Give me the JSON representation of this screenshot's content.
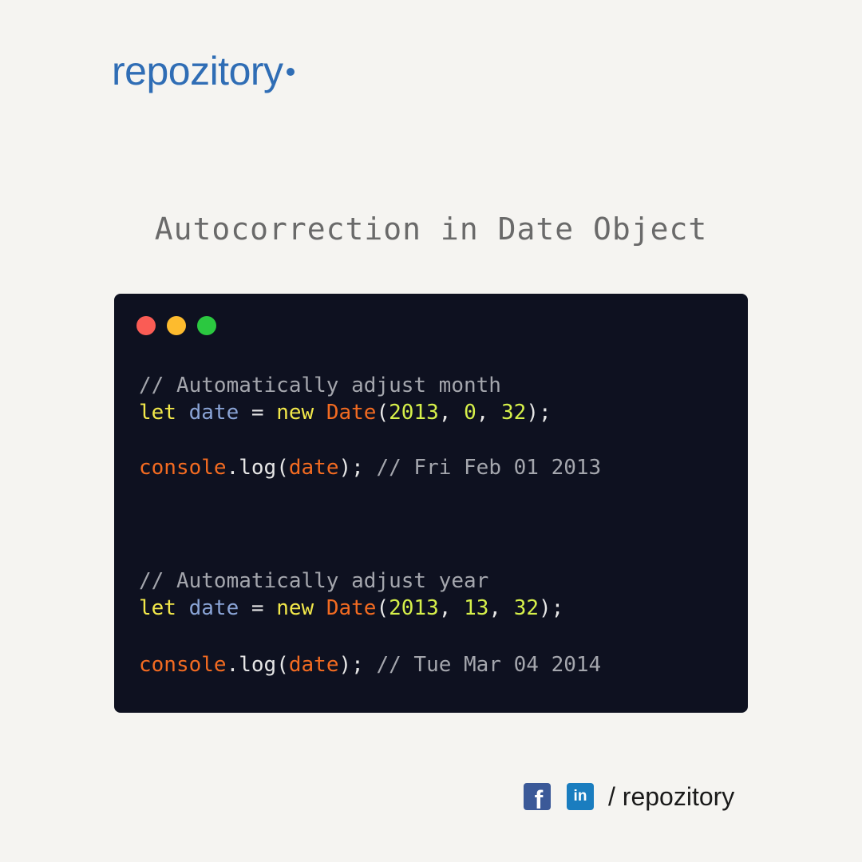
{
  "brand": {
    "name": "repozitory",
    "accent_color": "#2f6db5"
  },
  "title": "Autocorrection in Date Object",
  "editor": {
    "background": "#0e1120",
    "traffic_lights": [
      "#fa5c55",
      "#fdbb2e",
      "#2bc840"
    ],
    "block1": {
      "comment": "// Automatically adjust month",
      "decl_keyword": "let",
      "var_name": "date",
      "equals": "=",
      "new_keyword": "new",
      "class_name": "Date",
      "open_paren": "(",
      "arg1": "2013",
      "sep1": ", ",
      "arg2": "0",
      "sep2": ", ",
      "arg3": "32",
      "close": ");",
      "log_object": "console",
      "log_method": ".log(",
      "log_arg": "date",
      "log_close": ");",
      "log_comment": "// Fri Feb 01 2013"
    },
    "block2": {
      "comment": "// Automatically adjust year",
      "decl_keyword": "let",
      "var_name": "date",
      "equals": "=",
      "new_keyword": "new",
      "class_name": "Date",
      "open_paren": "(",
      "arg1": "2013",
      "sep1": ", ",
      "arg2": "13",
      "sep2": ", ",
      "arg3": "32",
      "close": ");",
      "log_object": "console",
      "log_method": ".log(",
      "log_arg": "date",
      "log_close": ");",
      "log_comment": "// Tue Mar 04 2014"
    }
  },
  "footer": {
    "facebook_icon": "facebook-icon",
    "facebook_glyph": "f",
    "linkedin_icon": "linkedin-icon",
    "linkedin_glyph": "in",
    "handle": "/ repozitory"
  }
}
